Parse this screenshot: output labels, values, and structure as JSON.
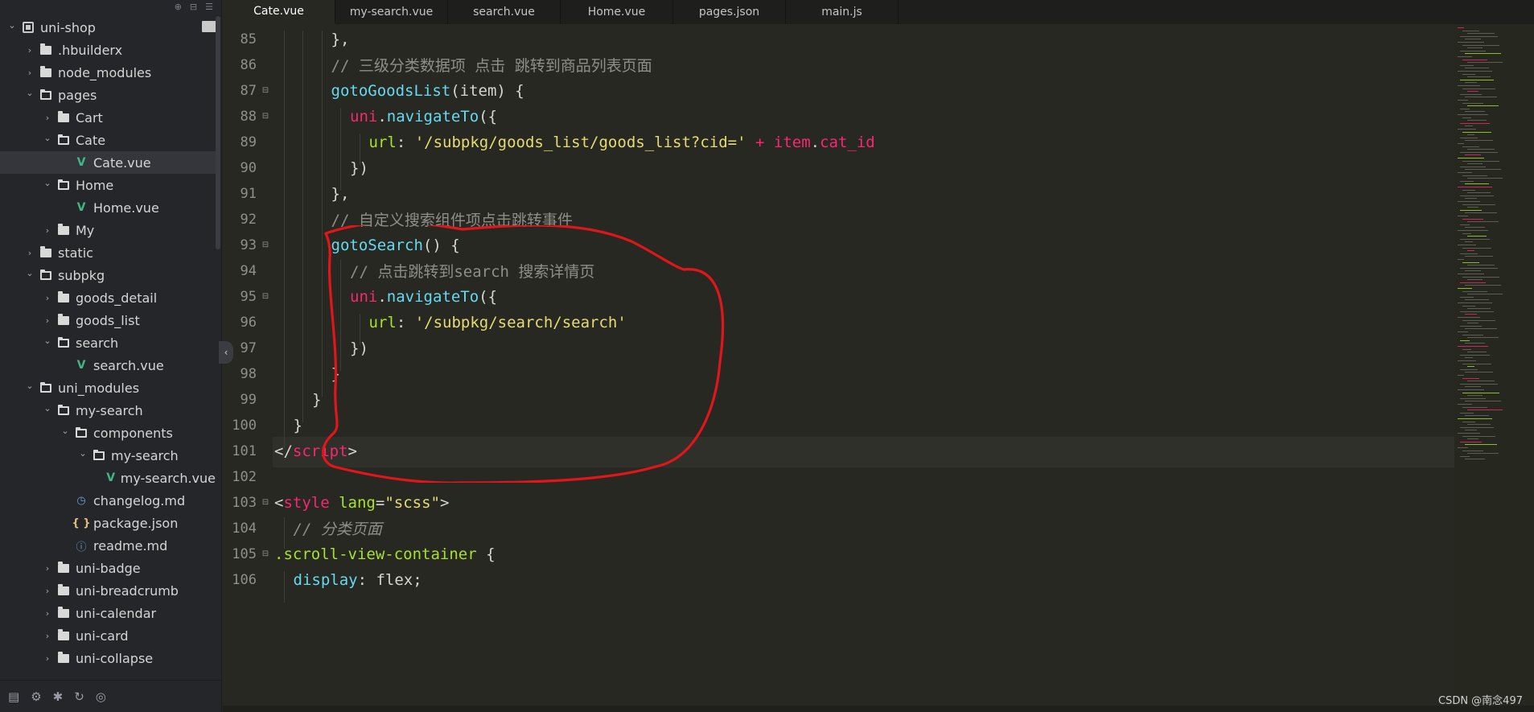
{
  "sidebar": {
    "tree": [
      {
        "label": "uni-shop",
        "depth": 0,
        "kind": "project",
        "expanded": true,
        "icon": "project-icon"
      },
      {
        "label": ".hbuilderx",
        "depth": 1,
        "kind": "folder",
        "expanded": false
      },
      {
        "label": "node_modules",
        "depth": 1,
        "kind": "folder",
        "expanded": false
      },
      {
        "label": "pages",
        "depth": 1,
        "kind": "folder",
        "expanded": true
      },
      {
        "label": "Cart",
        "depth": 2,
        "kind": "folder",
        "expanded": false
      },
      {
        "label": "Cate",
        "depth": 2,
        "kind": "folder",
        "expanded": true
      },
      {
        "label": "Cate.vue",
        "depth": 3,
        "kind": "vue",
        "selected": true
      },
      {
        "label": "Home",
        "depth": 2,
        "kind": "folder",
        "expanded": true
      },
      {
        "label": "Home.vue",
        "depth": 3,
        "kind": "vue"
      },
      {
        "label": "My",
        "depth": 2,
        "kind": "folder",
        "expanded": false
      },
      {
        "label": "static",
        "depth": 1,
        "kind": "folder",
        "expanded": false
      },
      {
        "label": "subpkg",
        "depth": 1,
        "kind": "folder",
        "expanded": true
      },
      {
        "label": "goods_detail",
        "depth": 2,
        "kind": "folder",
        "expanded": false
      },
      {
        "label": "goods_list",
        "depth": 2,
        "kind": "folder",
        "expanded": false
      },
      {
        "label": "search",
        "depth": 2,
        "kind": "folder",
        "expanded": true
      },
      {
        "label": "search.vue",
        "depth": 3,
        "kind": "vue"
      },
      {
        "label": "uni_modules",
        "depth": 1,
        "kind": "folder",
        "expanded": true
      },
      {
        "label": "my-search",
        "depth": 2,
        "kind": "folder",
        "expanded": true
      },
      {
        "label": "components",
        "depth": 3,
        "kind": "folder",
        "expanded": true
      },
      {
        "label": "my-search",
        "depth": 4,
        "kind": "folder",
        "expanded": true
      },
      {
        "label": "my-search.vue",
        "depth": 5,
        "kind": "vue"
      },
      {
        "label": "changelog.md",
        "depth": 3,
        "kind": "md"
      },
      {
        "label": "package.json",
        "depth": 3,
        "kind": "json"
      },
      {
        "label": "readme.md",
        "depth": 3,
        "kind": "info"
      },
      {
        "label": "uni-badge",
        "depth": 2,
        "kind": "folder",
        "expanded": false
      },
      {
        "label": "uni-breadcrumb",
        "depth": 2,
        "kind": "folder",
        "expanded": false
      },
      {
        "label": "uni-calendar",
        "depth": 2,
        "kind": "folder",
        "expanded": false
      },
      {
        "label": "uni-card",
        "depth": 2,
        "kind": "folder",
        "expanded": false
      },
      {
        "label": "uni-collapse",
        "depth": 2,
        "kind": "folder",
        "expanded": false
      }
    ]
  },
  "tabs": [
    {
      "label": "Cate.vue",
      "active": true
    },
    {
      "label": "my-search.vue",
      "active": false
    },
    {
      "label": "search.vue",
      "active": false
    },
    {
      "label": "Home.vue",
      "active": false
    },
    {
      "label": "pages.json",
      "active": false
    },
    {
      "label": "main.js",
      "active": false
    }
  ],
  "editor": {
    "lines": [
      {
        "n": "85",
        "fold": false,
        "indent": 3,
        "parts": [
          [
            "plain",
            "},"
          ]
        ]
      },
      {
        "n": "86",
        "fold": false,
        "indent": 3,
        "parts": [
          [
            "cmt",
            "// 三级分类数据项 点击 跳转到商品列表页面"
          ]
        ]
      },
      {
        "n": "87",
        "fold": true,
        "indent": 3,
        "parts": [
          [
            "fn",
            "gotoGoodsList"
          ],
          [
            "plain",
            "(item) {"
          ]
        ]
      },
      {
        "n": "88",
        "fold": true,
        "indent": 4,
        "parts": [
          [
            "obj",
            "uni"
          ],
          [
            "plain",
            "."
          ],
          [
            "fn",
            "navigateTo"
          ],
          [
            "plain",
            "({"
          ]
        ]
      },
      {
        "n": "89",
        "fold": false,
        "indent": 5,
        "parts": [
          [
            "key",
            "url"
          ],
          [
            "plain",
            ": "
          ],
          [
            "str",
            "'/subpkg/goods_list/goods_list?cid='"
          ],
          [
            "plain",
            " "
          ],
          [
            "obj",
            "+"
          ],
          [
            "plain",
            " "
          ],
          [
            "obj",
            "item"
          ],
          [
            "plain",
            "."
          ],
          [
            "obj",
            "cat_id"
          ]
        ]
      },
      {
        "n": "90",
        "fold": false,
        "indent": 4,
        "parts": [
          [
            "plain",
            "})"
          ]
        ]
      },
      {
        "n": "91",
        "fold": false,
        "indent": 3,
        "parts": [
          [
            "plain",
            "},"
          ]
        ]
      },
      {
        "n": "92",
        "fold": false,
        "indent": 3,
        "parts": [
          [
            "cmt",
            "// 自定义搜索组件项点击跳转事件"
          ]
        ]
      },
      {
        "n": "93",
        "fold": true,
        "indent": 3,
        "parts": [
          [
            "fn",
            "gotoSearch"
          ],
          [
            "plain",
            "() {"
          ]
        ]
      },
      {
        "n": "94",
        "fold": false,
        "indent": 4,
        "parts": [
          [
            "cmt",
            "// 点击跳转到search 搜索详情页"
          ]
        ]
      },
      {
        "n": "95",
        "fold": true,
        "indent": 4,
        "parts": [
          [
            "obj",
            "uni"
          ],
          [
            "plain",
            "."
          ],
          [
            "fn",
            "navigateTo"
          ],
          [
            "plain",
            "({"
          ]
        ]
      },
      {
        "n": "96",
        "fold": false,
        "indent": 5,
        "parts": [
          [
            "key",
            "url"
          ],
          [
            "plain",
            ": "
          ],
          [
            "str",
            "'/subpkg/search/search'"
          ]
        ]
      },
      {
        "n": "97",
        "fold": false,
        "indent": 4,
        "parts": [
          [
            "plain",
            "})"
          ]
        ]
      },
      {
        "n": "98",
        "fold": false,
        "indent": 3,
        "parts": [
          [
            "plain",
            "}"
          ]
        ]
      },
      {
        "n": "99",
        "fold": false,
        "indent": 2,
        "parts": [
          [
            "plain",
            "}"
          ]
        ]
      },
      {
        "n": "100",
        "fold": false,
        "indent": 1,
        "parts": [
          [
            "plain",
            "}"
          ]
        ]
      },
      {
        "n": "101",
        "fold": false,
        "indent": 0,
        "parts": [
          [
            "plain",
            "</"
          ],
          [
            "tag",
            "script"
          ],
          [
            "plain",
            ">"
          ]
        ]
      },
      {
        "n": "102",
        "fold": false,
        "indent": 0,
        "parts": []
      },
      {
        "n": "103",
        "fold": true,
        "indent": 0,
        "parts": [
          [
            "plain",
            "<"
          ],
          [
            "tag",
            "style"
          ],
          [
            "plain",
            " "
          ],
          [
            "attr",
            "lang"
          ],
          [
            "plain",
            "="
          ],
          [
            "str",
            "\"scss\""
          ],
          [
            "plain",
            ">"
          ]
        ]
      },
      {
        "n": "104",
        "fold": false,
        "indent": 1,
        "parts": [
          [
            "cmt it",
            "// 分类页面"
          ]
        ]
      },
      {
        "n": "105",
        "fold": true,
        "indent": 0,
        "parts": [
          [
            "sel",
            ".scroll-view-container"
          ],
          [
            "plain",
            " {"
          ]
        ]
      },
      {
        "n": "106",
        "fold": false,
        "indent": 1,
        "parts": [
          [
            "prop",
            "display"
          ],
          [
            "plain",
            ": flex;"
          ]
        ]
      }
    ]
  },
  "status": {
    "watermark": "CSDN @南念497"
  },
  "colors": {
    "annotation": "#e0161b",
    "background": "#272822",
    "sidebar": "#25262a"
  }
}
